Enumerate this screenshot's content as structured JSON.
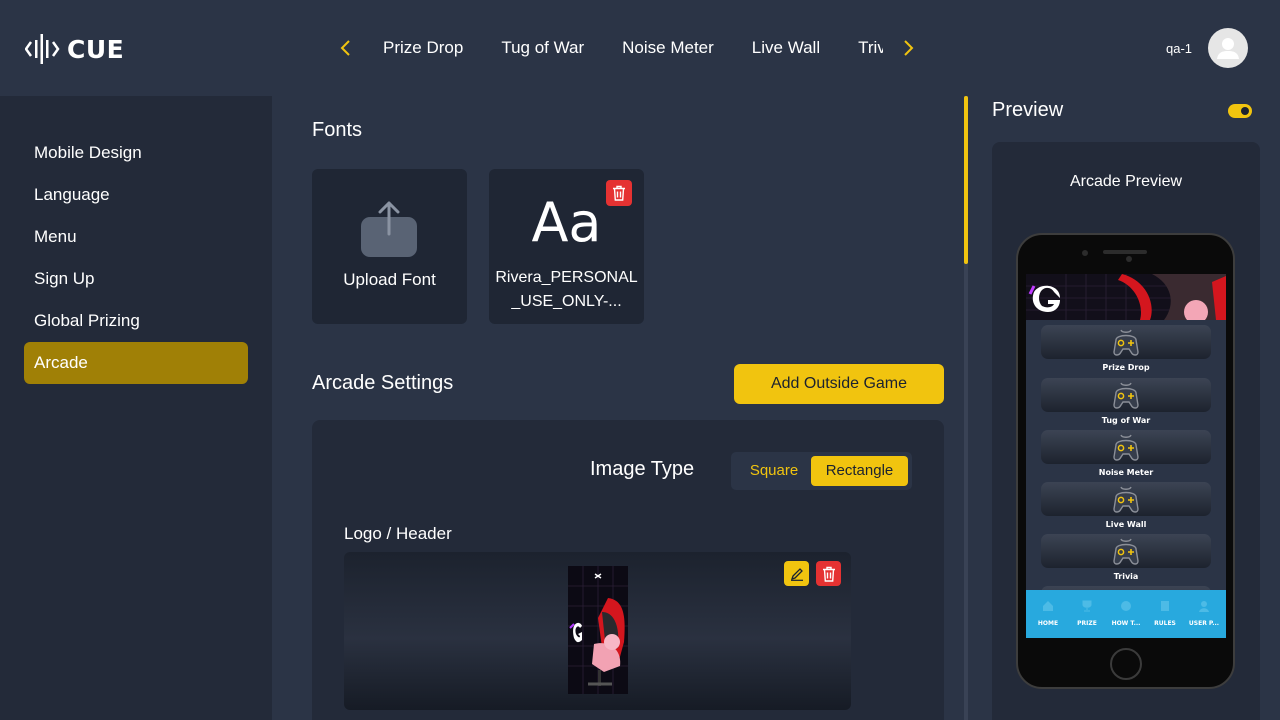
{
  "brand": {
    "name": "CUE"
  },
  "nav": {
    "tabs": [
      "Prize Drop",
      "Tug of War",
      "Noise Meter",
      "Live Wall",
      "Trivia"
    ],
    "prev_icon": "chevron-left-icon",
    "next_icon": "chevron-right-icon"
  },
  "user": {
    "name": "qa-1"
  },
  "sidebar": {
    "items": [
      {
        "label": "Mobile Design",
        "active": false
      },
      {
        "label": "Language",
        "active": false
      },
      {
        "label": "Menu",
        "active": false
      },
      {
        "label": "Sign Up",
        "active": false
      },
      {
        "label": "Global Prizing",
        "active": false
      },
      {
        "label": "Arcade",
        "active": true
      }
    ]
  },
  "fonts": {
    "title": "Fonts",
    "upload_label": "Upload Font",
    "sample_glyph": "Aa",
    "uploaded_font_name": "Rivera_PERSONAL_USE_ONLY-..."
  },
  "arcade": {
    "title": "Arcade Settings",
    "add_button": "Add Outside Game",
    "image_type_label": "Image Type",
    "image_type_options": [
      "Square",
      "Rectangle"
    ],
    "image_type_selected": "Rectangle",
    "logo_header_label": "Logo / Header"
  },
  "preview": {
    "title": "Preview",
    "toggle_on": true,
    "label": "Arcade Preview",
    "games": [
      "Prize Drop",
      "Tug of War",
      "Noise Meter",
      "Live Wall",
      "Trivia"
    ],
    "bottom_nav": [
      "HOME",
      "PRIZE",
      "HOW T...",
      "RULES",
      "USER P..."
    ]
  },
  "colors": {
    "accent": "#f1c40f",
    "active_sidebar": "#a08006",
    "danger": "#e53232",
    "background": "#2b3446",
    "sidebar_bg": "#232a39",
    "phone_nav": "#28a9de"
  }
}
